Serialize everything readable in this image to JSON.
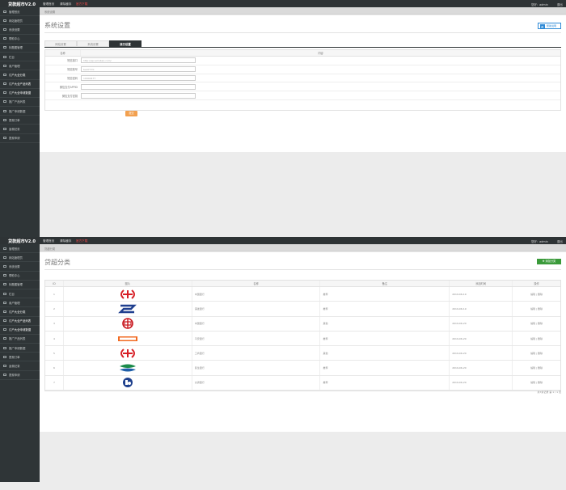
{
  "app": {
    "logo": "贷款超市V2.0",
    "nav": [
      "管理首页",
      "清除缓存",
      "官方下载"
    ],
    "admin_text": "您好：admin",
    "logout": "退出"
  },
  "sidebar": {
    "items": [
      {
        "label": "管理首页",
        "icon": "home-icon"
      },
      {
        "label": "网站管理员",
        "icon": "user-icon"
      },
      {
        "label": "系统设置",
        "icon": "gear-icon"
      },
      {
        "label": "帮助中心",
        "icon": "help-icon"
      },
      {
        "label": "标题图管理",
        "icon": "image-icon"
      },
      {
        "label": "栏目",
        "icon": "list-icon"
      },
      {
        "label": "用户管理",
        "icon": "users-icon"
      },
      {
        "label": "订户大全分类",
        "icon": "folder-icon"
      },
      {
        "label": "订户大全产品列表",
        "icon": "list-icon"
      },
      {
        "label": "订户大全申请数据",
        "icon": "data-icon"
      },
      {
        "label": "推广产品列表",
        "icon": "list-icon"
      },
      {
        "label": "推广申请数据",
        "icon": "data-icon"
      },
      {
        "label": "提现订单",
        "icon": "money-icon"
      },
      {
        "label": "返佣记录",
        "icon": "record-icon"
      },
      {
        "label": "提现申请",
        "icon": "apply-icon"
      }
    ]
  },
  "screen1": {
    "breadcrumb": "系统设置",
    "title": "系统设置",
    "help_button": "帮助说明",
    "tabs": [
      "网站设置",
      "系统设置",
      "接口设置"
    ],
    "table_head": {
      "name": "名称",
      "content": "内容"
    },
    "fields": [
      {
        "label": "短信接口",
        "value": "http://api.smsbao.com/"
      },
      {
        "label": "短信账号",
        "value": "test7770"
      },
      {
        "label": "短信密码",
        "value": "19940477"
      },
      {
        "label": "微信支付APPID",
        "value": ""
      },
      {
        "label": "微信支付密钥",
        "value": ""
      }
    ],
    "save_button": "提交"
  },
  "screen2": {
    "breadcrumb": "贷超分类",
    "title": "贷超分类",
    "add_button": "添加分类",
    "columns": [
      "ID",
      "图片",
      "名称",
      "备注",
      "添加时间",
      "操作"
    ],
    "rows": [
      {
        "id": "1",
        "name": "中国银行",
        "note": "推荐",
        "time": "2019-06-19",
        "ops": "编辑 | 删除",
        "logo": "icbc-style-red"
      },
      {
        "id": "2",
        "name": "浦发银行",
        "note": "推荐",
        "time": "2019-06-19",
        "ops": "编辑 | 删除",
        "logo": "spdb-style-blue"
      },
      {
        "id": "3",
        "name": "中国银行",
        "note": "其他",
        "time": "2019-06-20",
        "ops": "编辑 | 删除",
        "logo": "boc-style-red"
      },
      {
        "id": "4",
        "name": "平安银行",
        "note": "推荐",
        "time": "2019-06-20",
        "ops": "编辑 | 删除",
        "logo": "pingan-style-orange"
      },
      {
        "id": "5",
        "name": "工商银行",
        "note": "其他",
        "time": "2019-06-20",
        "ops": "编辑 | 删除",
        "logo": "icbc-style-red"
      },
      {
        "id": "6",
        "name": "民生银行",
        "note": "推荐",
        "time": "2019-06-20",
        "ops": "编辑 | 删除",
        "logo": "cmbc-style-green"
      },
      {
        "id": "7",
        "name": "交通银行",
        "note": "推荐",
        "time": "2019-06-20",
        "ops": "编辑 | 删除",
        "logo": "bocom-style-blue"
      }
    ],
    "pager": "共7条记录 第 1 / 1 页"
  }
}
